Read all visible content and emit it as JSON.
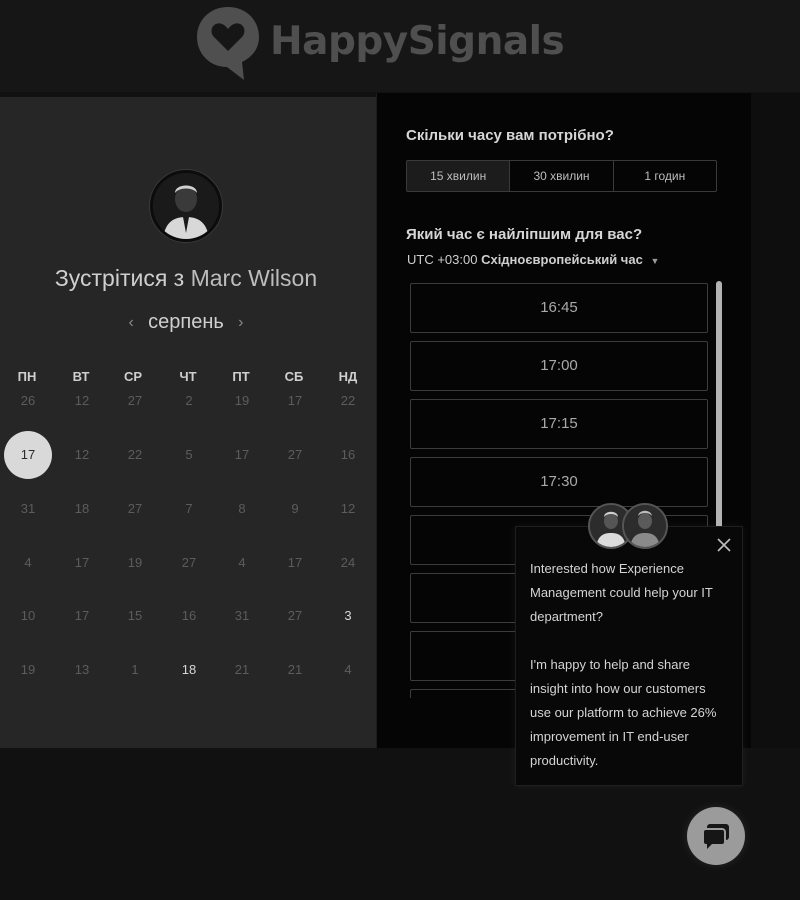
{
  "brand": {
    "name": "HappySignals"
  },
  "calendar": {
    "title_prefix": "Зустрітися з",
    "host_name": "Marc Wilson",
    "month": "серпень",
    "weekdays": [
      "ПН",
      "ВТ",
      "СР",
      "ЧТ",
      "ПТ",
      "СБ",
      "НД"
    ],
    "weeks": [
      [
        "26",
        "12",
        "27",
        "2",
        "19",
        "17",
        "22"
      ],
      [
        "17",
        "12",
        "22",
        "5",
        "17",
        "27",
        "16"
      ],
      [
        "31",
        "18",
        "27",
        "7",
        "8",
        "9",
        "12"
      ],
      [
        "4",
        "17",
        "19",
        "27",
        "4",
        "17",
        "24"
      ],
      [
        "10",
        "17",
        "15",
        "16",
        "31",
        "27",
        "3"
      ],
      [
        "19",
        "13",
        "1",
        "18",
        "21",
        "21",
        "4"
      ]
    ],
    "selected_day": "17",
    "available_days": [
      "3",
      "18"
    ]
  },
  "scheduler": {
    "duration_question": "Скільки часу вам потрібно?",
    "durations": [
      "15 хвилин",
      "30 хвилин",
      "1 годин"
    ],
    "active_duration": "15 хвилин",
    "time_question": "Який час є найліпшим для вас?",
    "timezone_offset": "UTC +03:00",
    "timezone_name": "Східноєвропейський час",
    "slots": [
      "16:45",
      "17:00",
      "17:15",
      "17:30",
      "",
      "",
      "",
      ""
    ]
  },
  "chat": {
    "message_1": "Interested how Experience Management could help your IT department?",
    "message_2": "I'm happy to help and share insight into how our customers use our platform to achieve 26% improvement in IT end-user productivity."
  }
}
